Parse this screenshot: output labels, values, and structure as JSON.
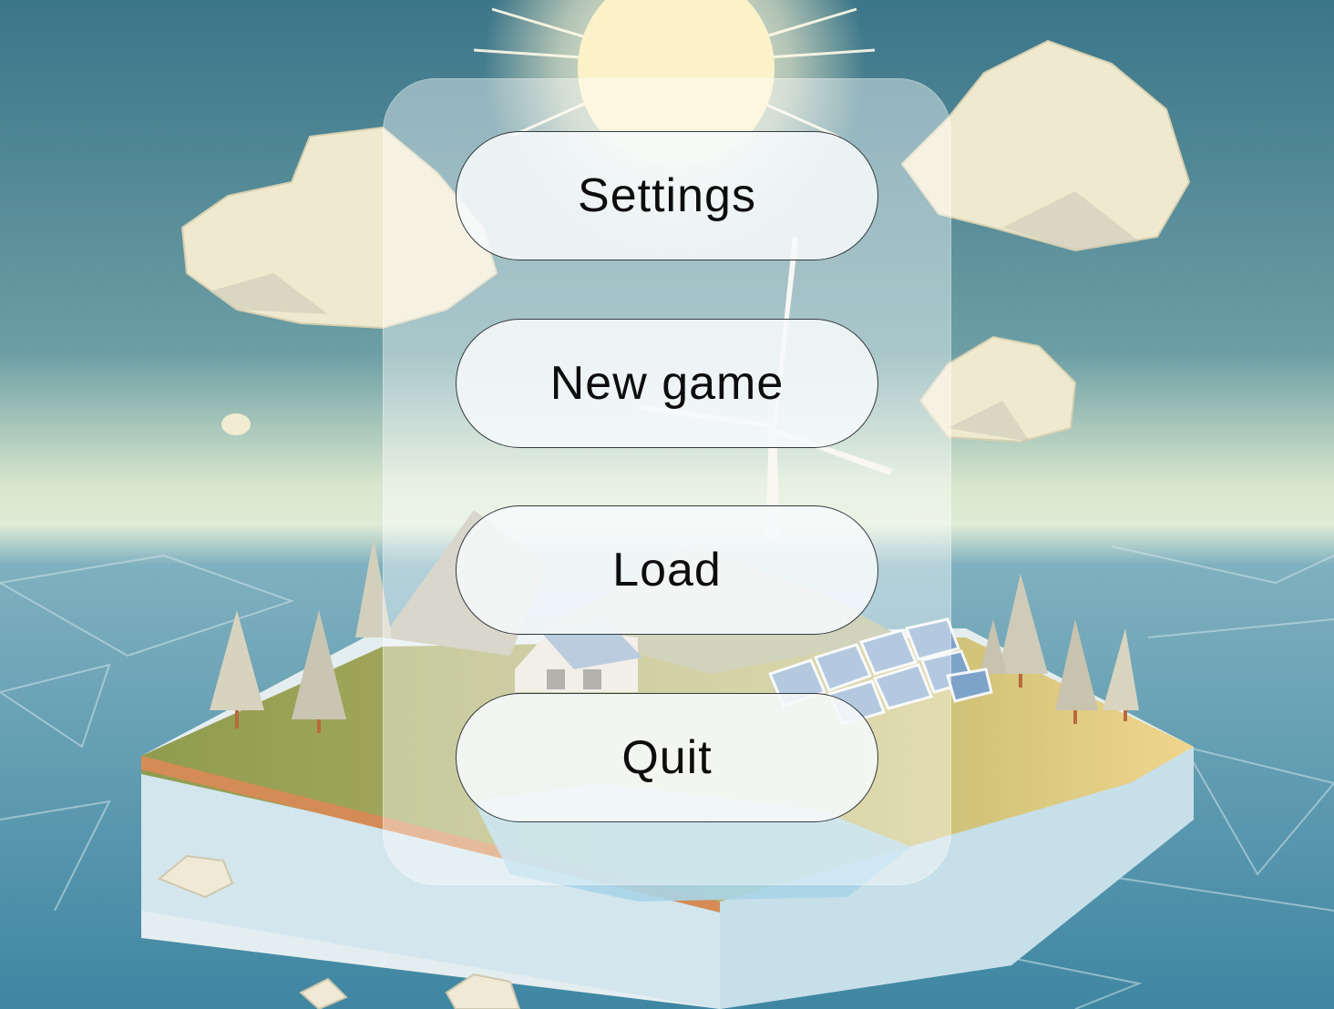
{
  "menu": {
    "settings_label": "Settings",
    "new_game_label": "New game",
    "load_label": "Load",
    "quit_label": "Quit"
  },
  "colors": {
    "sky_top": "#3f7b8f",
    "sky_horizon": "#e4efd6",
    "ocean": "#4e8fa8",
    "island_grass": "#9aa85c",
    "island_sand": "#efd48a",
    "cloud": "#f1ecd2",
    "button_border": "#333a3d"
  },
  "scene_elements": {
    "sun": "sun-icon",
    "clouds": "cloud-icon",
    "trees": "tree-icon",
    "wind_turbine": "wind-turbine-icon",
    "solar_panels": "solar-panel-icon",
    "house": "house-icon"
  }
}
